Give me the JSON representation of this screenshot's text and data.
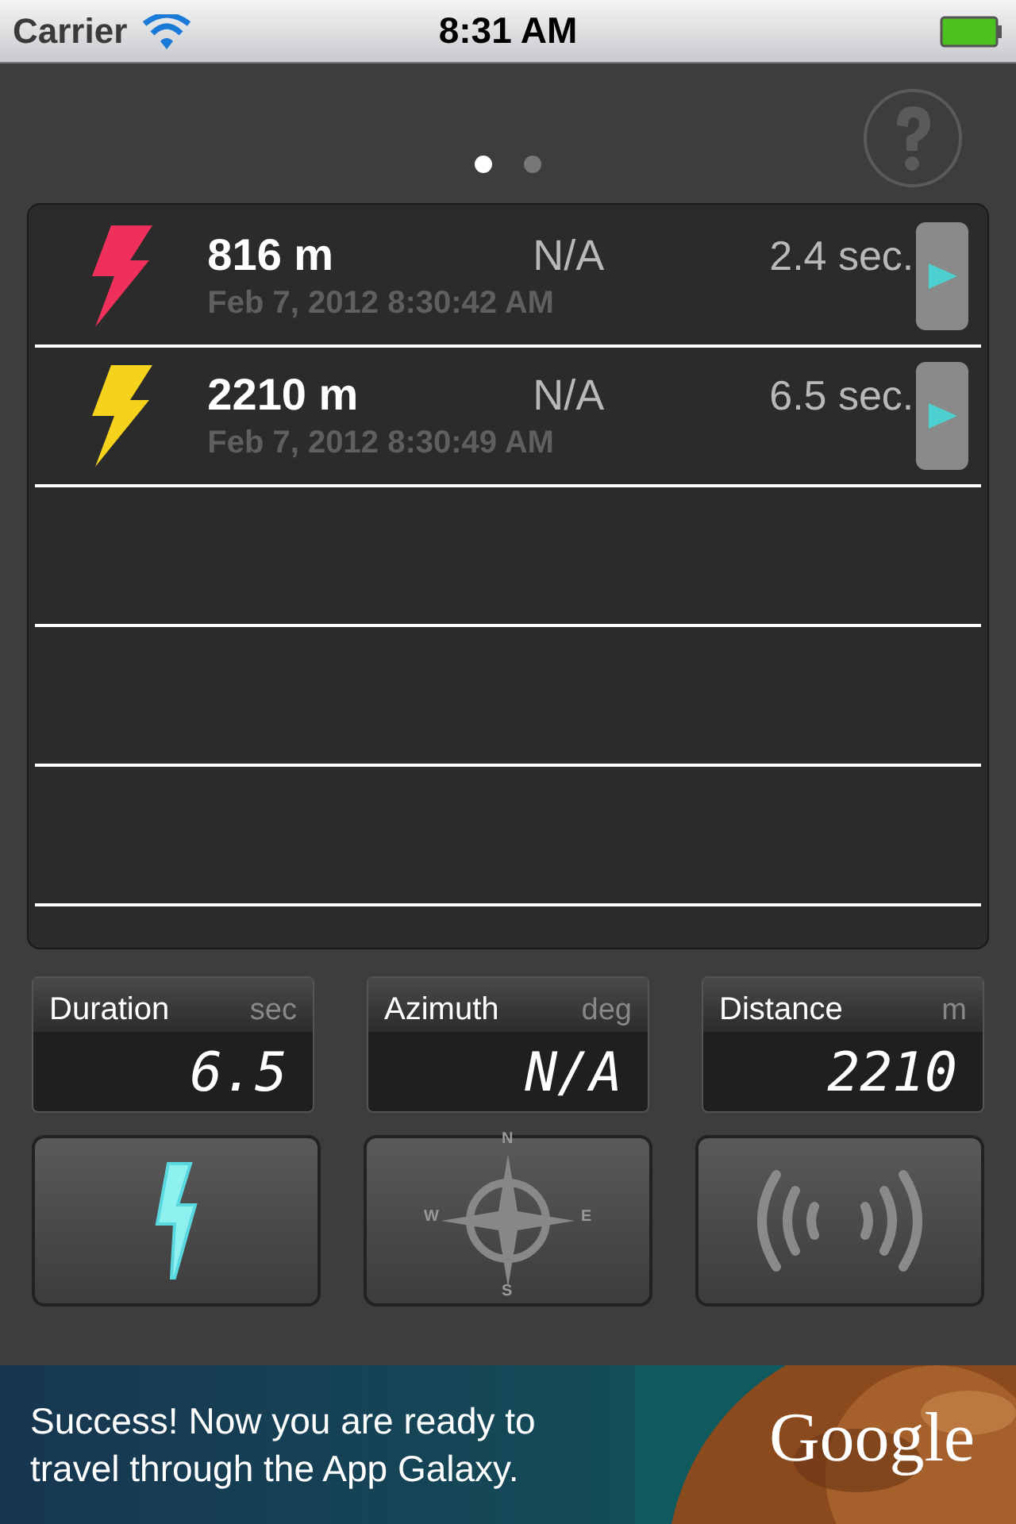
{
  "status_bar": {
    "carrier": "Carrier",
    "time": "8:31 AM"
  },
  "page_dots": [
    {
      "selected": true
    },
    {
      "selected": false
    }
  ],
  "strikes": [
    {
      "color": "#f0305c",
      "distance": "816 m",
      "azimuth": "N/A",
      "duration": "2.4 sec.",
      "timestamp": "Feb 7, 2012 8:30:42 AM"
    },
    {
      "color": "#f5d21c",
      "distance": "2210 m",
      "azimuth": "N/A",
      "duration": "6.5 sec.",
      "timestamp": "Feb 7, 2012 8:30:49 AM"
    }
  ],
  "readouts": [
    {
      "label": "Duration",
      "unit": "sec",
      "value": "6.5"
    },
    {
      "label": "Azimuth",
      "unit": "deg",
      "value": "N/A"
    },
    {
      "label": "Distance",
      "unit": "m",
      "value": "2210"
    }
  ],
  "buttons": [
    {
      "kind": "flash"
    },
    {
      "kind": "compass",
      "letters": [
        "N",
        "W",
        "E",
        "S"
      ]
    },
    {
      "kind": "sound"
    }
  ],
  "ad": {
    "lines": [
      "Success! Now you are ready to",
      "travel through the App Galaxy."
    ],
    "brand": "Google"
  }
}
